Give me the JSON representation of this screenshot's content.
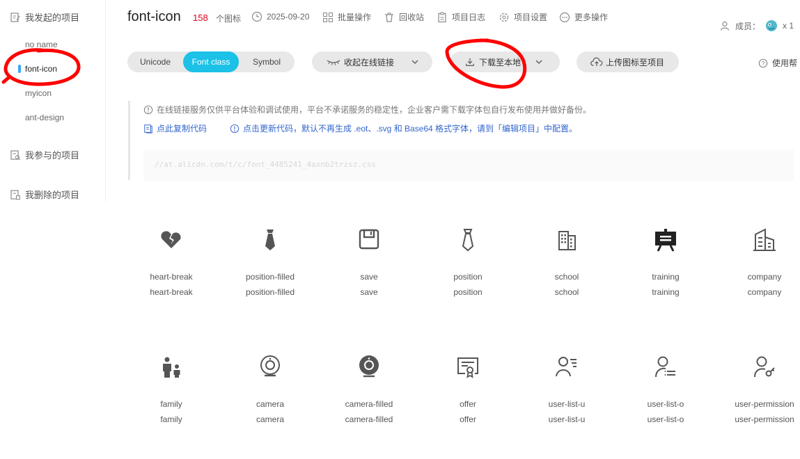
{
  "sidebar": {
    "my_projects": "我发起的项目",
    "projects": [
      "no name",
      "font-icon",
      "myicon",
      "ant-design"
    ],
    "joined": "我参与的项目",
    "deleted": "我删除的项目"
  },
  "header": {
    "title": "font-icon",
    "count": "158",
    "count_unit": "个图标",
    "date": "2025-09-20",
    "actions": [
      "批量操作",
      "回收站",
      "项目日志",
      "项目设置",
      "更多操作"
    ],
    "members_label": "成员：",
    "members_count": "x 1"
  },
  "toolbar": {
    "segments": [
      "Unicode",
      "Font class",
      "Symbol"
    ],
    "active_segment": "Font class",
    "collapse_link": "收起在线链接",
    "download": "下载至本地",
    "upload": "上传图标至项目",
    "help": "使用帮"
  },
  "notice": {
    "warning": "在线链接服务仅供平台体验和调试使用，平台不承诺服务的稳定性，企业客户需下载字体包自行发布使用并做好备份。",
    "copy_code": "点此复制代码",
    "update_code": "点击更新代码，默认不再生成 .eot、.svg 和 Base64 格式字体，请到「编辑项目」中配置。",
    "code_url": "//at.alicdn.com/t/c/font_4485241_4axnb2trzsz.css"
  },
  "icons": [
    {
      "icon": "heart-break-icon",
      "name": "heart-break",
      "code": "heart-break"
    },
    {
      "icon": "tie-filled-icon",
      "name": "position-filled",
      "code": "position-filled"
    },
    {
      "icon": "save-icon",
      "name": "save",
      "code": "save"
    },
    {
      "icon": "tie-outline-icon",
      "name": "position",
      "code": "position"
    },
    {
      "icon": "building-icon",
      "name": "school",
      "code": "school"
    },
    {
      "icon": "easel-icon",
      "name": "training",
      "code": "training"
    },
    {
      "icon": "company-icon",
      "name": "company",
      "code": "company"
    },
    {
      "icon": "family-icon",
      "name": "family",
      "code": "family"
    },
    {
      "icon": "camera-icon",
      "name": "camera",
      "code": "camera"
    },
    {
      "icon": "camera-filled-icon",
      "name": "camera-filled",
      "code": "camera-filled"
    },
    {
      "icon": "certificate-icon",
      "name": "offer",
      "code": "offer"
    },
    {
      "icon": "user-list-icon",
      "name": "user-list-u",
      "code": "user-list-u"
    },
    {
      "icon": "user-list-alt-icon",
      "name": "user-list-o",
      "code": "user-list-o"
    },
    {
      "icon": "user-key-icon",
      "name": "user-permission",
      "code": "user-permission"
    }
  ],
  "colors": {
    "accent": "#1bc1e6",
    "count_red": "#d9001b",
    "link_blue": "#3366cc",
    "annotation_red": "#ff0000"
  }
}
